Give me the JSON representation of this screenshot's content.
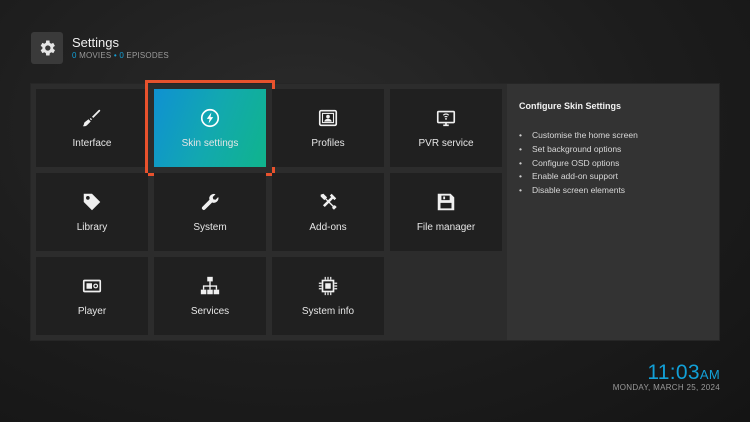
{
  "header": {
    "title": "Settings",
    "movies_count": "0",
    "movies_label": "MOVIES",
    "separator": "•",
    "episodes_count": "0",
    "episodes_label": "EPISODES",
    "icon": "gear-icon"
  },
  "tiles": [
    {
      "label": "Interface",
      "icon": "paintbrush-icon"
    },
    {
      "label": "Skin settings",
      "icon": "skin-icon",
      "focused": true
    },
    {
      "label": "Profiles",
      "icon": "profile-icon"
    },
    {
      "label": "PVR service",
      "icon": "tv-antenna-icon"
    },
    {
      "label": "Library",
      "icon": "tag-icon"
    },
    {
      "label": "System",
      "icon": "wrench-icon"
    },
    {
      "label": "Add-ons",
      "icon": "tools-icon"
    },
    {
      "label": "File manager",
      "icon": "floppy-disk-icon"
    },
    {
      "label": "Player",
      "icon": "player-icon"
    },
    {
      "label": "Services",
      "icon": "network-icon"
    },
    {
      "label": "System info",
      "icon": "cpu-icon"
    }
  ],
  "info": {
    "title": "Configure Skin Settings",
    "items": [
      "Customise the home screen",
      "Set background options",
      "Configure OSD options",
      "Enable add-on support",
      "Disable screen elements"
    ]
  },
  "clock": {
    "time": "11:03",
    "ampm": "AM",
    "date": "MONDAY, MARCH 25, 2024"
  },
  "colors": {
    "accent": "#12a0d7",
    "focus_outline": "#e8522d",
    "gradient_start": "#0f91d2",
    "gradient_end": "#10b48c"
  }
}
